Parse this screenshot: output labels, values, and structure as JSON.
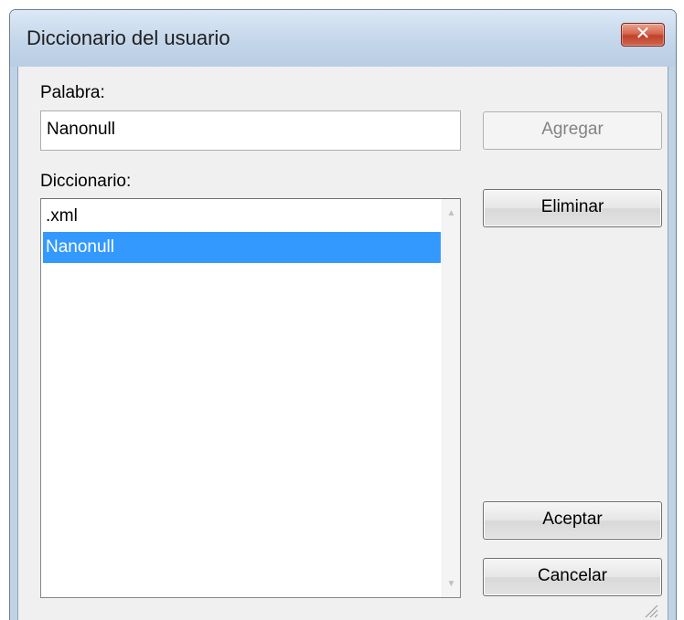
{
  "window": {
    "title": "Diccionario del usuario",
    "close_glyph": "✕"
  },
  "word": {
    "label": "Palabra:",
    "value": "Nanonull"
  },
  "dictionary": {
    "label": "Diccionario:",
    "items": [
      {
        "text": ".xml",
        "selected": false
      },
      {
        "text": "Nanonull",
        "selected": true
      }
    ]
  },
  "buttons": {
    "add": "Agregar",
    "remove": "Eliminar",
    "ok": "Aceptar",
    "cancel": "Cancelar"
  },
  "colors": {
    "selection": "#3399ff",
    "close_button": "#c7432d"
  }
}
